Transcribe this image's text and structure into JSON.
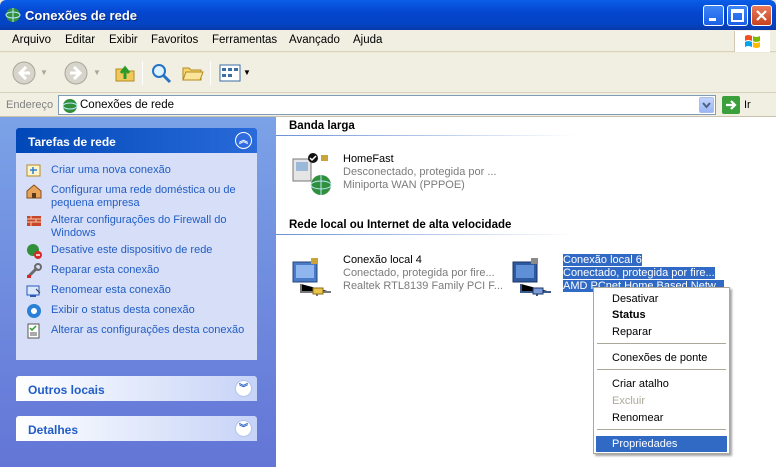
{
  "window": {
    "title": "Conexões de rede"
  },
  "menu": [
    "Arquivo",
    "Editar",
    "Exibir",
    "Favoritos",
    "Ferramentas",
    "Avançado",
    "Ajuda"
  ],
  "address": {
    "label": "Endereço",
    "value": "Conexões de rede",
    "go_label": "Ir"
  },
  "left_pane": {
    "tasks_title": "Tarefas de rede",
    "tasks": [
      "Criar uma nova conexão",
      "Configurar uma rede doméstica ou de pequena empresa",
      "Alterar configurações do Firewall do Windows",
      "Desative este dispositivo de rede",
      "Reparar esta conexão",
      "Renomear esta conexão",
      "Exibir o status desta conexão",
      "Alterar as configurações desta conexão"
    ],
    "other_places_title": "Outros locais",
    "details_title": "Detalhes"
  },
  "sections": [
    {
      "title": "Banda larga",
      "connections": [
        {
          "name": "HomeFast",
          "status": "Desconectado, protegida por ...",
          "device": "Miniporta WAN (PPPOE)"
        }
      ]
    },
    {
      "title": "Rede local ou Internet de alta velocidade",
      "connections": [
        {
          "name": "Conexão local 4",
          "status": "Conectado, protegida por fire...",
          "device": "Realtek RTL8139 Family PCI F..."
        },
        {
          "name": "Conexão local 6",
          "status": "Conectado, protegida por fire...",
          "device": "AMD PCnet Home Based Netw..."
        }
      ]
    }
  ],
  "context_menu": [
    {
      "label": "Desativar",
      "state": "normal"
    },
    {
      "label": "Status",
      "state": "bold"
    },
    {
      "label": "Reparar",
      "state": "normal"
    },
    {
      "label": "Conexões de ponte",
      "state": "normal"
    },
    {
      "label": "Criar atalho",
      "state": "normal"
    },
    {
      "label": "Excluir",
      "state": "disabled"
    },
    {
      "label": "Renomear",
      "state": "normal"
    },
    {
      "label": "Propriedades",
      "state": "highlighted"
    }
  ],
  "colors": {
    "title_bar": "#0546d0",
    "selection": "#316ac5",
    "link": "#215dc6",
    "task_panel": "#d6dff7"
  }
}
